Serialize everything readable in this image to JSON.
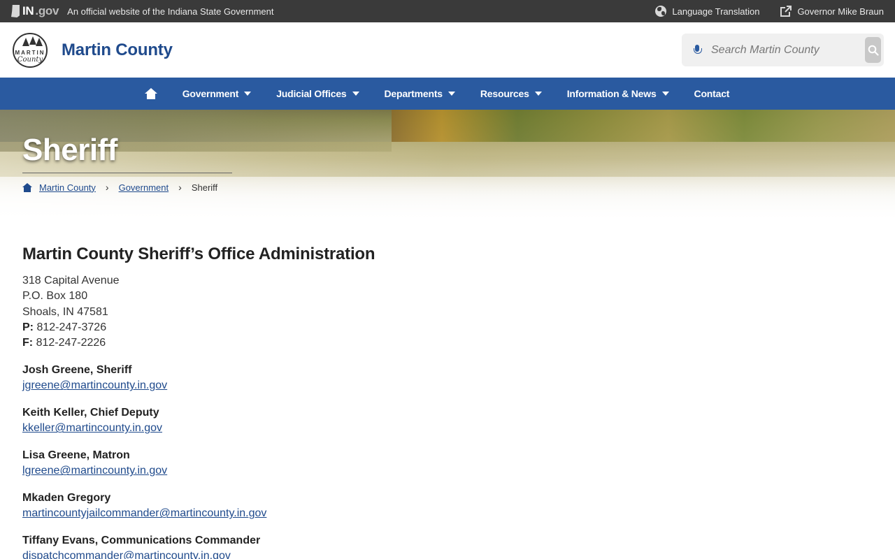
{
  "topbar": {
    "logo_text": "IN",
    "logo_suffix": ".gov",
    "official_text": "An official website of the Indiana State Government",
    "language_label": "Language Translation",
    "governor_label": "Governor Mike Braun"
  },
  "header": {
    "seal_band": "MARTIN",
    "seal_script": "County",
    "site_title": "Martin County",
    "search_placeholder": "Search Martin County"
  },
  "nav": {
    "items": [
      {
        "label": "Government"
      },
      {
        "label": "Judicial Offices"
      },
      {
        "label": "Departments"
      },
      {
        "label": "Resources"
      },
      {
        "label": "Information & News"
      },
      {
        "label": "Contact"
      }
    ]
  },
  "hero": {
    "title": "Sheriff",
    "breadcrumb": [
      "Martin County",
      "Government",
      "Sheriff"
    ]
  },
  "content": {
    "heading": "Martin County Sheriff’s Office Administration",
    "address": [
      "318 Capital Avenue",
      "P.O. Box 180",
      "Shoals, IN 47581"
    ],
    "phone_label": "P:",
    "phone": "812-247-3726",
    "fax_label": "F:",
    "fax": "812-247-2226",
    "contacts": [
      {
        "name": "Josh Greene, Sheriff",
        "email": "jgreene@martincounty.in.gov"
      },
      {
        "name": "Keith Keller, Chief Deputy",
        "email": "kkeller@martincounty.in.gov"
      },
      {
        "name": "Lisa Greene, Matron",
        "email": "lgreene@martincounty.in.gov"
      },
      {
        "name": "Mkaden Gregory",
        "email": "martincountyjailcommander@martincounty.in.gov"
      },
      {
        "name": "Tiffany Evans, Communications Commander",
        "email": "dispatchcommander@martincounty.in.gov"
      }
    ]
  },
  "colors": {
    "topbar": "#3a3a3a",
    "brand_blue": "#1f4a8c",
    "nav_blue": "#2a5aa0"
  }
}
